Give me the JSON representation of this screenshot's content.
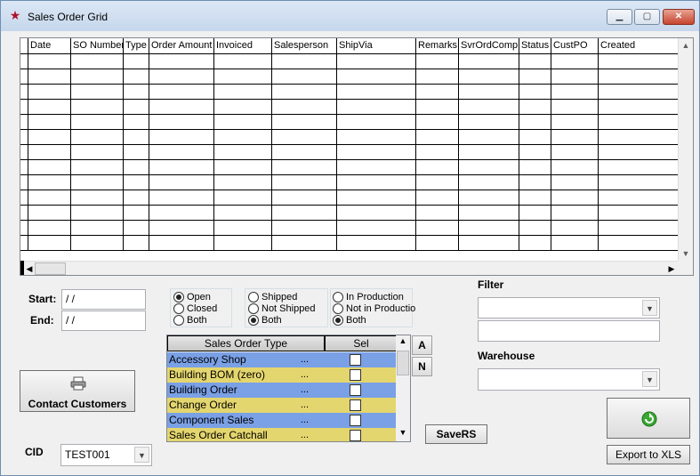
{
  "window": {
    "title": "Sales Order Grid",
    "min_glyph": "▁",
    "max_glyph": "▢",
    "close_glyph": "✕",
    "app_icon": "star-icon"
  },
  "grid": {
    "columns": [
      {
        "label": ""
      },
      {
        "label": "Date"
      },
      {
        "label": "SO Number"
      },
      {
        "label": "Type"
      },
      {
        "label": "Order Amount"
      },
      {
        "label": "Invoiced"
      },
      {
        "label": "Salesperson"
      },
      {
        "label": "ShipVia"
      },
      {
        "label": "Remarks"
      },
      {
        "label": "SvrOrdComp"
      },
      {
        "label": "Status"
      },
      {
        "label": "CustPO"
      },
      {
        "label": "Created"
      }
    ],
    "row_count": 13
  },
  "dates": {
    "start_label": "Start:",
    "end_label": "End:",
    "start_value": " / /",
    "end_value": " / /"
  },
  "status_group": {
    "options": [
      "Open",
      "Closed",
      "Both"
    ],
    "selected": "Open"
  },
  "ship_group": {
    "options": [
      "Shipped",
      "Not Shipped",
      "Both"
    ],
    "selected": "Both"
  },
  "production_group": {
    "options": [
      "In Production",
      "Not in Productio",
      "Both"
    ],
    "selected": "Both"
  },
  "sales_order_types": {
    "header_type": "Sales Order Type",
    "header_sel": "Sel",
    "rows": [
      {
        "name": "Accessory Shop",
        "dots": "...",
        "color": "#7aa0e6"
      },
      {
        "name": "Building BOM (zero)",
        "dots": "...",
        "color": "#e4d66e"
      },
      {
        "name": "Building Order",
        "dots": "...",
        "color": "#7aa0e6"
      },
      {
        "name": "Change Order",
        "dots": "...",
        "color": "#e4d66e"
      },
      {
        "name": "Component Sales",
        "dots": "...",
        "color": "#7aa0e6"
      },
      {
        "name": "Sales Order Catchall",
        "dots": "...",
        "color": "#e4d66e"
      }
    ]
  },
  "side_buttons": {
    "a_label": "A",
    "n_label": "N"
  },
  "filter": {
    "label": "Filter",
    "select_value": "",
    "text_value": ""
  },
  "warehouse": {
    "label": "Warehouse",
    "select_value": ""
  },
  "buttons": {
    "contact_customers": "Contact Customers",
    "save_rs": "SaveRS",
    "export_xls": "Export to XLS",
    "refresh_icon": "refresh-icon",
    "printer_icon": "printer-icon"
  },
  "cid": {
    "label": "CID",
    "value": "TEST001"
  },
  "colors": {
    "row_blue": "#7aa0e6",
    "row_yellow": "#e4d66e",
    "refresh_green": "#3aa832"
  }
}
